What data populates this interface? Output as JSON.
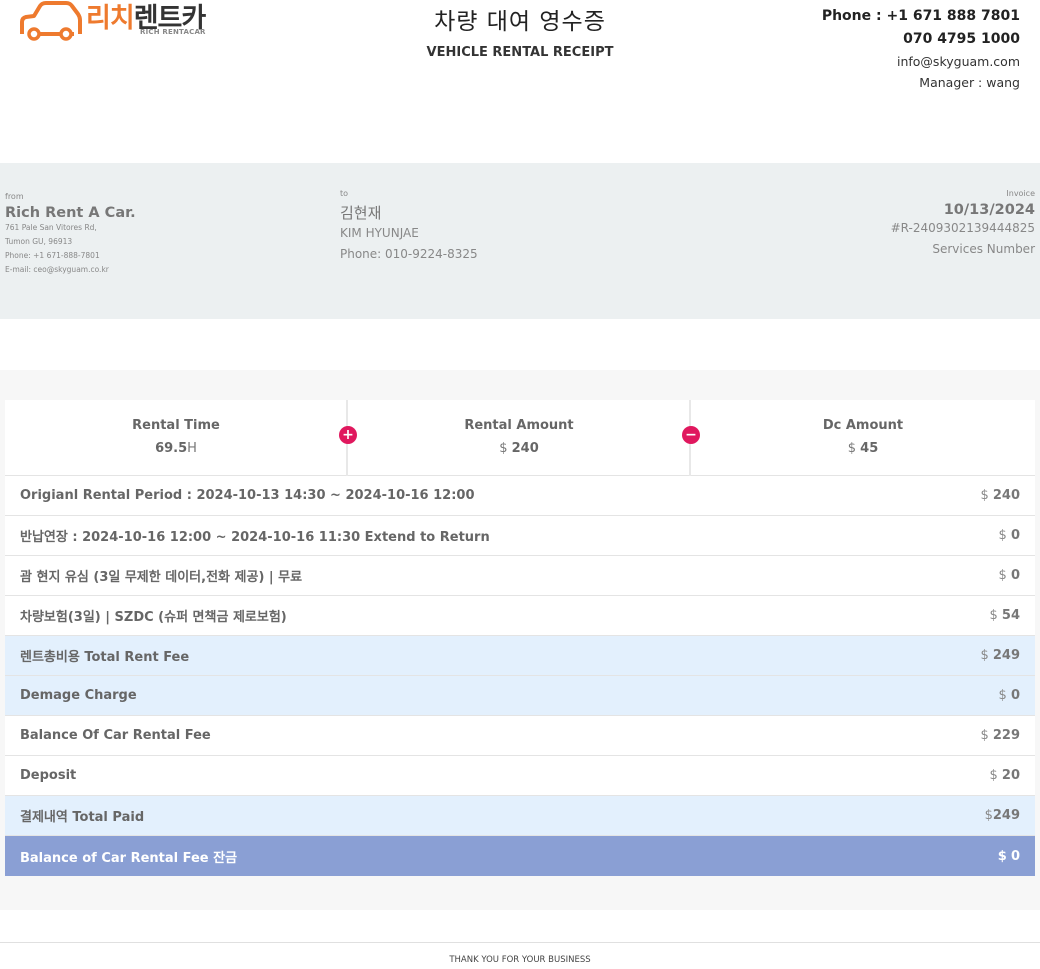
{
  "logo": {
    "text_orange": "리치",
    "text_dark": "렌트카",
    "sub": "RICH RENTACAR"
  },
  "title": {
    "korean": "차량 대여 영수증",
    "english": "VEHICLE RENTAL RECEIPT"
  },
  "contact": {
    "phone": "Phone : +1 671 888 7801",
    "phone2": "070 4795 1000",
    "email": "info@skyguam.com",
    "manager": "Manager : wang"
  },
  "from": {
    "label": "from",
    "name": "Rich Rent A Car.",
    "address1": "761 Pale San Vitores Rd,",
    "address2": "Tumon GU, 96913",
    "phone": "Phone: +1 671-888-7801",
    "email": "E-mail: ceo@skyguam.co.kr"
  },
  "to": {
    "label": "to",
    "name_ko": "김현재",
    "name_en": "KIM HYUNJAE",
    "phone": "Phone: 010-9224-8325"
  },
  "invoice": {
    "label": "Invoice",
    "date": "10/13/2024",
    "number": "#R-2409302139444825",
    "services_label": "Services Number"
  },
  "summary": {
    "rental_time_label": "Rental Time",
    "rental_time_value": "69.5",
    "rental_time_unit": "H",
    "rental_amount_label": "Rental Amount",
    "rental_amount_currency": "$",
    "rental_amount_value": "240",
    "dc_amount_label": "Dc Amount",
    "dc_amount_currency": "$",
    "dc_amount_value": "45",
    "plus_symbol": "+",
    "minus_symbol": "−"
  },
  "rows": [
    {
      "label": "Origianl Rental Period : 2024-10-13 14:30 ~ 2024-10-16 12:00",
      "currency": "$",
      "value": "240"
    },
    {
      "label": "반납연장 : 2024-10-16 12:00 ~ 2024-10-16 11:30 Extend to Return",
      "currency": "$",
      "value": "0"
    },
    {
      "label": "괌 현지 유심 (3일 무제한 데이터,전화 제공) | 무료",
      "currency": "$",
      "value": "0"
    },
    {
      "label": "차량보험(3일) | SZDC (슈퍼 면책금 제로보험)",
      "currency": "$",
      "value": "54"
    },
    {
      "label": "렌트총비용 Total Rent Fee",
      "currency": "$",
      "value": "249"
    },
    {
      "label": "Demage Charge",
      "currency": "$",
      "value": "0"
    },
    {
      "label": "Balance Of Car Rental Fee",
      "currency": "$",
      "value": "229"
    },
    {
      "label": "Deposit",
      "currency": "$",
      "value": "20"
    },
    {
      "label": "결제내역 Total Paid",
      "currency": "$",
      "value": "249"
    },
    {
      "label": "Balance of Car Rental Fee 잔금",
      "currency": "$",
      "value": "0"
    }
  ],
  "footer": "THANK YOU FOR YOUR BUSINESS",
  "colors": {
    "logo_orange": "#ee7a2e",
    "info_band": "#ecf0f1",
    "highlight_row": "#e3f0fd",
    "balance_row": "#8a9fd4",
    "operator_circle": "#e0185e"
  }
}
